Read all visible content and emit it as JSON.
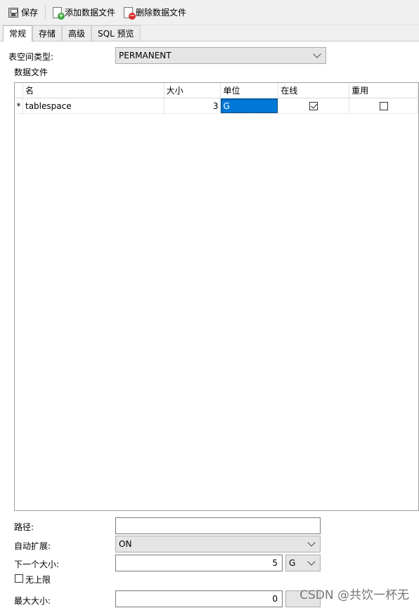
{
  "toolbar": {
    "save_label": "保存",
    "add_file_label": "添加数据文件",
    "delete_file_label": "删除数据文件"
  },
  "tabs": [
    {
      "label": "常规",
      "active": true
    },
    {
      "label": "存储",
      "active": false
    },
    {
      "label": "高级",
      "active": false
    },
    {
      "label": "SQL 预览",
      "active": false
    }
  ],
  "form": {
    "tablespace_type_label": "表空间类型:",
    "tablespace_type_value": "PERMANENT",
    "datafiles_label": "数据文件",
    "path_label": "路径:",
    "path_value": "",
    "autoextend_label": "自动扩展:",
    "autoextend_value": "ON",
    "next_size_label": "下一个大小:",
    "next_size_value": "5",
    "next_size_unit": "G",
    "unlimited_label": "无上限",
    "unlimited_checked": false,
    "max_size_label": "最大大小:",
    "max_size_value": "0"
  },
  "grid": {
    "columns": [
      "名",
      "大小",
      "单位",
      "在线",
      "重用"
    ],
    "rows": [
      {
        "indicator": "*",
        "name": "tablespace",
        "size": "3",
        "unit": "G",
        "online": true,
        "reuse": false
      }
    ]
  },
  "watermark": "CSDN @共饮一杯无",
  "colors": {
    "selection": "#0078d7",
    "background": "#f0f0f0"
  }
}
